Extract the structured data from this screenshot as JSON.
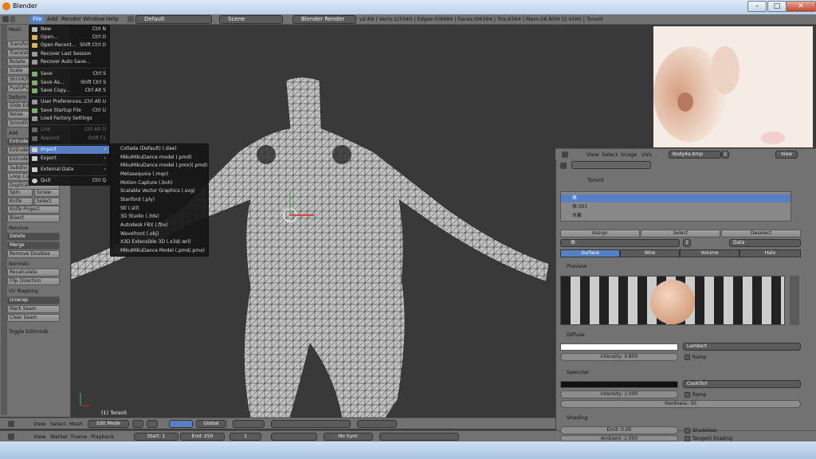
{
  "window": {
    "title": "Blender"
  },
  "topbar": {
    "menus": [
      "File",
      "Add",
      "Render",
      "Window",
      "Help"
    ],
    "layout": "Default",
    "scene": "Scene",
    "engine": "Blender Render",
    "stats": "v2.69 | Verts:1/3340 | Edges:0/9684 | Faces:0/6364 | Tris:6364 | Mem:26.85M (2.41M) | Torso5"
  },
  "toolshelf": {
    "items": [
      "Mesh",
      "Transform",
      "Translate",
      "Rotate",
      "Scale",
      "Shrink/Fa",
      "Push/Pull",
      "Deform",
      "Slide Edg",
      "Noise",
      "Smooth",
      "Add",
      "Extrude",
      "Extrude",
      "Extrude",
      "Subdivi",
      "Loop Cut",
      "Duplicat"
    ],
    "spin": "Spin",
    "screw": "Screw",
    "knife": "Knife",
    "select": "Select",
    "knife_project": "Knife Project",
    "bisect": "Bisect",
    "remove_label": "Remove:",
    "delete": "Delete",
    "merge": "Merge",
    "remove_doubles": "Remove Doubles",
    "normals_label": "Normals:",
    "recalculate": "Recalculate",
    "flip_direction": "Flip Direction",
    "uv_label": "UV Mapping:",
    "unwrap": "Unwrap",
    "mark_seam": "Mark Seam",
    "clear_seam": "Clear Seam",
    "toggle_editmode": "Toggle Editmode"
  },
  "filemenu": {
    "items": [
      {
        "label": "New",
        "shortcut": "Ctrl N"
      },
      {
        "label": "Open...",
        "shortcut": "Ctrl O"
      },
      {
        "label": "Open Recent...",
        "shortcut": "Shift Ctrl O"
      },
      {
        "label": "Recover Last Session",
        "shortcut": ""
      },
      {
        "label": "Recover Auto Save...",
        "shortcut": ""
      },
      {
        "label": "Save",
        "shortcut": "Ctrl S"
      },
      {
        "label": "Save As...",
        "shortcut": "Shift Ctrl S"
      },
      {
        "label": "Save Copy...",
        "shortcut": "Ctrl Alt S"
      },
      {
        "label": "User Preferences...",
        "shortcut": "Ctrl Alt U"
      },
      {
        "label": "Save Startup File",
        "shortcut": "Ctrl U"
      },
      {
        "label": "Load Factory Settings",
        "shortcut": ""
      },
      {
        "label": "Link",
        "shortcut": "Ctrl Alt O"
      },
      {
        "label": "Append",
        "shortcut": "Shift F1"
      },
      {
        "label": "Import",
        "shortcut": ""
      },
      {
        "label": "Export",
        "shortcut": ""
      },
      {
        "label": "External Data",
        "shortcut": ""
      },
      {
        "label": "Quit",
        "shortcut": "Ctrl Q"
      }
    ]
  },
  "importmenu": {
    "items": [
      "Collada (Default) (.dae)",
      "MikuMikuDance model (.pmd)",
      "MikuMikuDance model (.pmx)(.pmd)",
      "Metasequoia (.mqo)",
      "Motion Capture (.bvh)",
      "Scalable Vector Graphics (.svg)",
      "Stanford (.ply)",
      "Stl (.stl)",
      "3D Studio (.3ds)",
      "Autodesk FBX (.fbx)",
      "Wavefront (.obj)",
      "X3D Extensible 3D (.x3d/.wrl)",
      "MikuMikuDance Model (.pmd/.pmx)"
    ]
  },
  "viewport": {
    "object_label": "(1) Torso5"
  },
  "bottom3d": {
    "view": "View",
    "select": "Select",
    "mesh": "Mesh",
    "mode": "Edit Mode",
    "orientation": "Global"
  },
  "timeline": {
    "view": "View",
    "marker": "Marker",
    "frame": "Frame",
    "playback": "Playback",
    "start": "Start: 1",
    "end": "End: 250",
    "current": "1",
    "sync": "No Sync"
  },
  "uvheader": {
    "view": "View",
    "select": "Select",
    "image": "Image",
    "uvs": "UVs",
    "image_name": "Body4a.bmp",
    "users": "2",
    "view2": "View"
  },
  "properties": {
    "object": "Torso5",
    "materials": [
      "体",
      "体.001",
      "水着"
    ],
    "assign": "Assign",
    "select": "Select",
    "deselect": "Deselect",
    "material_name": "体",
    "users": "2",
    "data": "Data",
    "tabs": [
      "Surface",
      "Wire",
      "Volume",
      "Halo"
    ],
    "preview": "Preview",
    "diffuse": "Diffuse",
    "diffuse_shader": "Lambert",
    "diffuse_intensity": "Intensity: 0.800",
    "ramp": "Ramp",
    "specular": "Specular",
    "specular_shader": "CookTorr",
    "specular_intensity": "Intensity: 1.000",
    "hardness": "Hardness: 50",
    "shading": "Shading",
    "emit": "Emit: 0.00",
    "ambient": "Ambient: 1.000",
    "shadeless": "Shadeless",
    "tangent": "Tangent Shading"
  },
  "colors": {
    "accent": "#5680c2",
    "panel": "#727272",
    "viewport": "#393939"
  }
}
